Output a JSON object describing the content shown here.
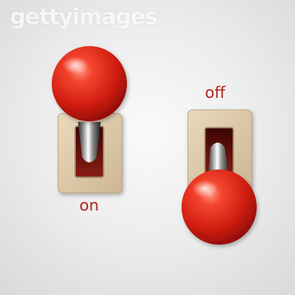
{
  "watermark": "gettyimages",
  "switches": [
    {
      "label": "on",
      "state": "on"
    },
    {
      "label": "off",
      "state": "off"
    }
  ],
  "colors": {
    "knob": "#e0281b",
    "plate": "#dcc8a8",
    "label": "#b0261a"
  }
}
